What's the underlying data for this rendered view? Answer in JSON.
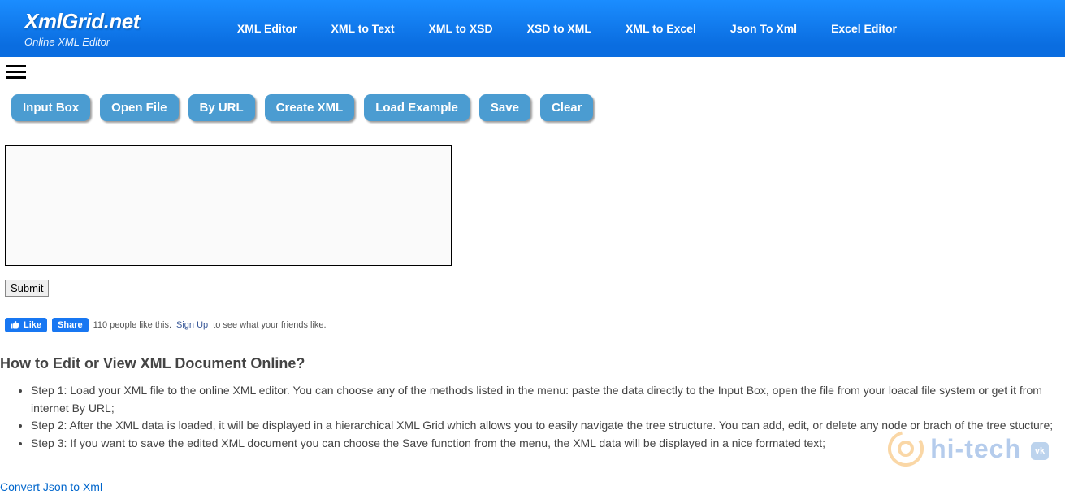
{
  "site": {
    "title": "XmlGrid.net",
    "subtitle": "Online XML Editor"
  },
  "nav": [
    "XML Editor",
    "XML to Text",
    "XML to XSD",
    "XSD to XML",
    "XML to Excel",
    "Json To Xml",
    "Excel Editor"
  ],
  "toolbar": {
    "input_box": "Input Box",
    "open_file": "Open File",
    "by_url": "By URL",
    "create_xml": "Create XML",
    "load_example": "Load Example",
    "save": "Save",
    "clear": "Clear"
  },
  "textarea_value": "",
  "submit_label": "Submit",
  "social": {
    "like_label": "Like",
    "share_label": "Share",
    "count_text": "110 people like this. ",
    "signup_label": "Sign Up",
    "tail_text": " to see what your friends like."
  },
  "howto": {
    "heading": "How to Edit or View XML Document Online?",
    "steps": [
      "Step 1: Load your XML file to the online XML editor. You can choose any of the methods listed in the menu: paste the data directly to the Input Box, open the file from your loacal file system or get it from internet By URL;",
      "Step 2: After the XML data is loaded, it will be displayed in a hierarchical XML Grid which allows you to easily navigate the tree structure. You can add, edit, or delete any node or brach of the tree stucture;",
      "Step 3: If you want to save the edited XML document you can choose the Save function from the menu, the XML data will be displayed in a nice formated text;"
    ]
  },
  "bottom_link": "Convert Json to Xml",
  "watermark": {
    "text": "hi-tech",
    "badge": "vk"
  }
}
